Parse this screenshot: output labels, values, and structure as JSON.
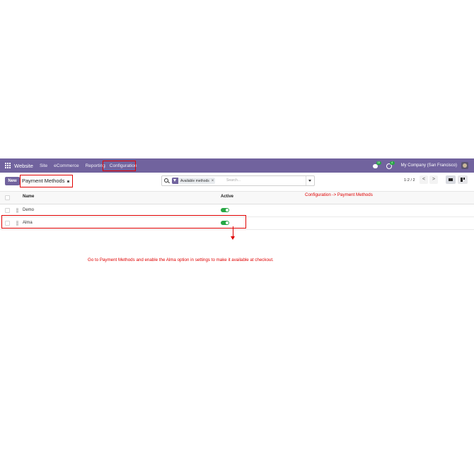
{
  "navbar": {
    "brand": "Website",
    "menu": [
      "Site",
      "eCommerce",
      "Reporting",
      "Configuration"
    ],
    "messages_count": "13",
    "activities_count": "4",
    "company": "My Company (San Francisco)"
  },
  "control_panel": {
    "new_label": "New",
    "breadcrumb": "Payment Methods",
    "search": {
      "facet": "Available methods",
      "placeholder": "Search..."
    },
    "pager": "1-2 / 2",
    "prev_glyph": "<",
    "next_glyph": ">"
  },
  "table": {
    "columns": [
      "Name",
      "Active"
    ],
    "rows": [
      {
        "name": "Demo",
        "active": true
      },
      {
        "name": "Alma",
        "active": true
      }
    ]
  },
  "annotations": {
    "top_note": "Configuration -> Payment Methods",
    "main_note": "Go to Payment Methods and enable the Alma option in settings to make it available at checkout.",
    "color": "#e00000"
  },
  "colors": {
    "navbar": "#71639e",
    "toggle_on": "#28a745"
  }
}
